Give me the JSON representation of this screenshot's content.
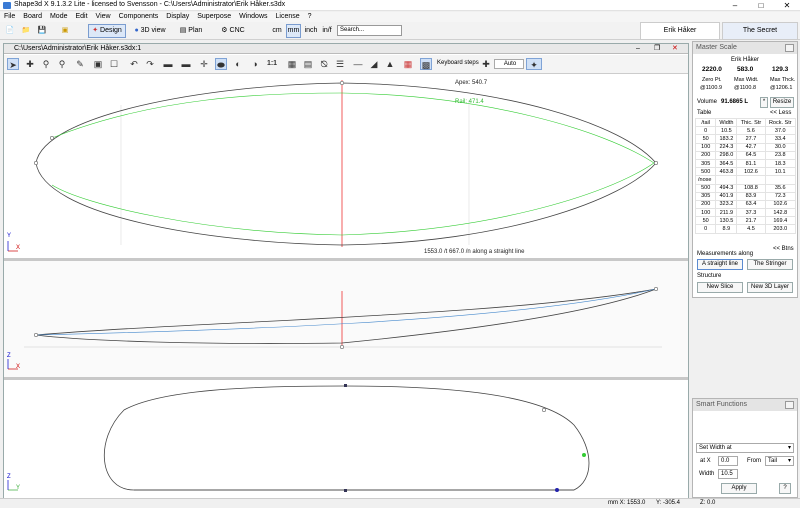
{
  "window": {
    "title": "Shape3d X 9.1.3.2 Lite - licensed to Svensson - C:\\Users\\Administrator\\Erik Håker.s3dx"
  },
  "menu": [
    "File",
    "Board",
    "Mode",
    "Edit",
    "View",
    "Components",
    "Display",
    "Superpose",
    "Windows",
    "License",
    "?"
  ],
  "toolbar": {
    "design": "Design",
    "view3d": "3D view",
    "plan": "Plan",
    "cnc": "CNC",
    "units": [
      "cm",
      "mm",
      "inch",
      "in/f"
    ],
    "active_unit": "mm",
    "search_placeholder": "Search..."
  },
  "tabs": {
    "left": "Erik Håker",
    "right": "The Secret"
  },
  "doc": {
    "title": "C:\\Users\\Administrator\\Erik Håker.s3dx:1",
    "keyboard_steps": "Keyboard steps",
    "auto": "Auto",
    "ratio": "1:1"
  },
  "outline": {
    "apex": "Apex: 540.7",
    "rail": "Rail: 471.4",
    "measure": "1553.0 /t 667.0 /n along a straight line"
  },
  "axes": {
    "x": "X",
    "y": "Y",
    "z": "Z"
  },
  "panel": {
    "title": "Master Scale",
    "name": "Erik Håker",
    "dims": [
      "2220.0",
      "583.0",
      "129.3"
    ],
    "dim_labels": [
      "Zero Pt.",
      "Max Widt.",
      "Max Thck."
    ],
    "dim_positions": [
      "@1100.9",
      "@1100.8",
      "@1206.1"
    ],
    "volume_label": "Volume",
    "volume": "91.6865 L",
    "star": "*",
    "resize": "Resize",
    "table_label": "Table",
    "less": "<< Less",
    "headers": [
      "/tail",
      "Width",
      "Thic. Str",
      "Rock. Str"
    ],
    "tail_rows": [
      [
        "0",
        "10.5",
        "5.6",
        "37.0"
      ],
      [
        "50",
        "183.2",
        "27.7",
        "33.4"
      ],
      [
        "100",
        "224.3",
        "42.7",
        "30.0"
      ],
      [
        "200",
        "298.0",
        "64.5",
        "23.8"
      ],
      [
        "305",
        "364.5",
        "81.1",
        "18.3"
      ],
      [
        "500",
        "463.8",
        "102.6",
        "10.1"
      ]
    ],
    "nose_label": "/nose",
    "nose_rows": [
      [
        "500",
        "494.3",
        "108.8",
        "35.6"
      ],
      [
        "305",
        "401.9",
        "83.9",
        "72.3"
      ],
      [
        "200",
        "323.2",
        "63.4",
        "102.6"
      ],
      [
        "100",
        "211.9",
        "37.3",
        "142.8"
      ],
      [
        "50",
        "130.5",
        "21.7",
        "169.4"
      ],
      [
        "0",
        "8.9",
        "4.5",
        "203.0"
      ]
    ],
    "btns": "<< Btns",
    "meas_label": "Measurements along",
    "meas_a": "A straight line",
    "meas_b": "The Stringer",
    "struct_label": "Structure",
    "new_slice": "New Slice",
    "new_layer": "New 3D Layer"
  },
  "smart": {
    "title": "Smart Functions",
    "func": "Set Width at",
    "atx_label": "at X",
    "atx": "0.0",
    "from_label": "From",
    "from": "Tail",
    "width_label": "Width",
    "width": "10.5",
    "apply": "Apply",
    "help": "?"
  },
  "status": {
    "x": "mm X: 1553.0",
    "y": "Y: -305.4",
    "z": "Z: 0.0"
  }
}
